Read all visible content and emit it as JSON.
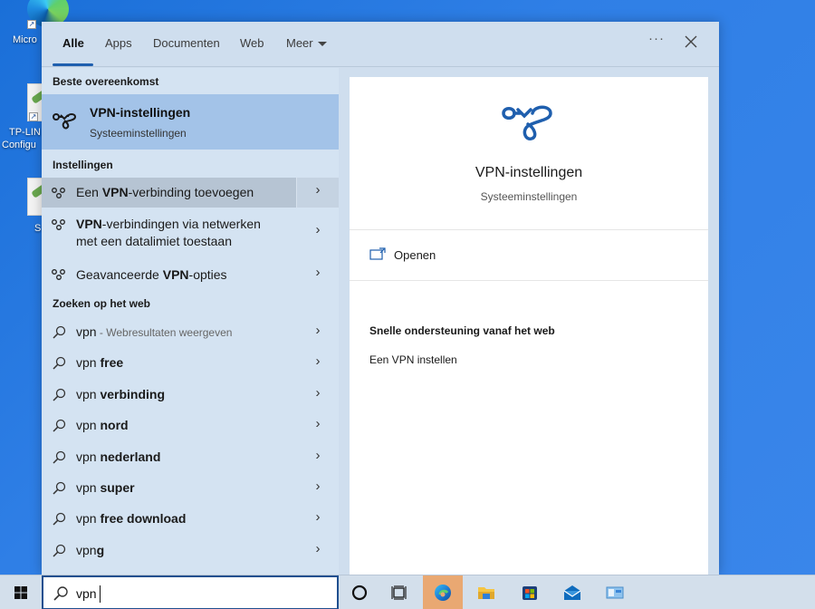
{
  "desktop": {
    "icons": [
      {
        "label": "Micro",
        "name": "microsoft-edge"
      },
      {
        "label": "TP-LIN",
        "label2": "Configu",
        "name": "tp-link-configuration"
      },
      {
        "label": "S",
        "name": "tp-link-shortcut"
      }
    ]
  },
  "tabs": {
    "items": [
      {
        "label": "Alle",
        "active": true
      },
      {
        "label": "Apps"
      },
      {
        "label": "Documenten"
      },
      {
        "label": "Web"
      },
      {
        "label": "Meer"
      }
    ],
    "more_label": "···",
    "close_icon": "close-icon"
  },
  "results": {
    "best_match_header": "Beste overeenkomst",
    "best_match": {
      "title": "VPN-instellingen",
      "subtitle": "Systeeminstellingen",
      "icon": "vpn-icon"
    },
    "settings_header": "Instellingen",
    "settings": [
      {
        "pre": "Een ",
        "bold": "VPN",
        "post": "-verbinding toevoegen"
      },
      {
        "pre": "",
        "bold": "VPN",
        "post": "-verbindingen via netwerken",
        "line2": "met een datalimiet toestaan"
      },
      {
        "pre": "Geavanceerde ",
        "bold": "VPN",
        "post": "-opties"
      }
    ],
    "web_header": "Zoeken op het web",
    "web": [
      {
        "query": "vpn",
        "suffix": "",
        "note": " - Webresultaten weergeven"
      },
      {
        "query": "vpn ",
        "suffix": "free"
      },
      {
        "query": "vpn ",
        "suffix": "verbinding"
      },
      {
        "query": "vpn ",
        "suffix": "nord"
      },
      {
        "query": "vpn ",
        "suffix": "nederland"
      },
      {
        "query": "vpn ",
        "suffix": "super"
      },
      {
        "query": "vpn ",
        "suffix": "free download"
      },
      {
        "query": "vpn",
        "suffix": "g"
      }
    ],
    "chevron": "›"
  },
  "details": {
    "title": "VPN-instellingen",
    "subtitle": "Systeeminstellingen",
    "open_label": "Openen",
    "web_help_title": "Snelle ondersteuning vanaf het web",
    "web_help_link": "Een VPN instellen",
    "accent": "#1f5fae"
  },
  "taskbar": {
    "search_value": "vpn",
    "apps": [
      "cortana",
      "task-view",
      "edge",
      "file-explorer",
      "microsoft-store",
      "mail",
      "control-panel"
    ]
  }
}
